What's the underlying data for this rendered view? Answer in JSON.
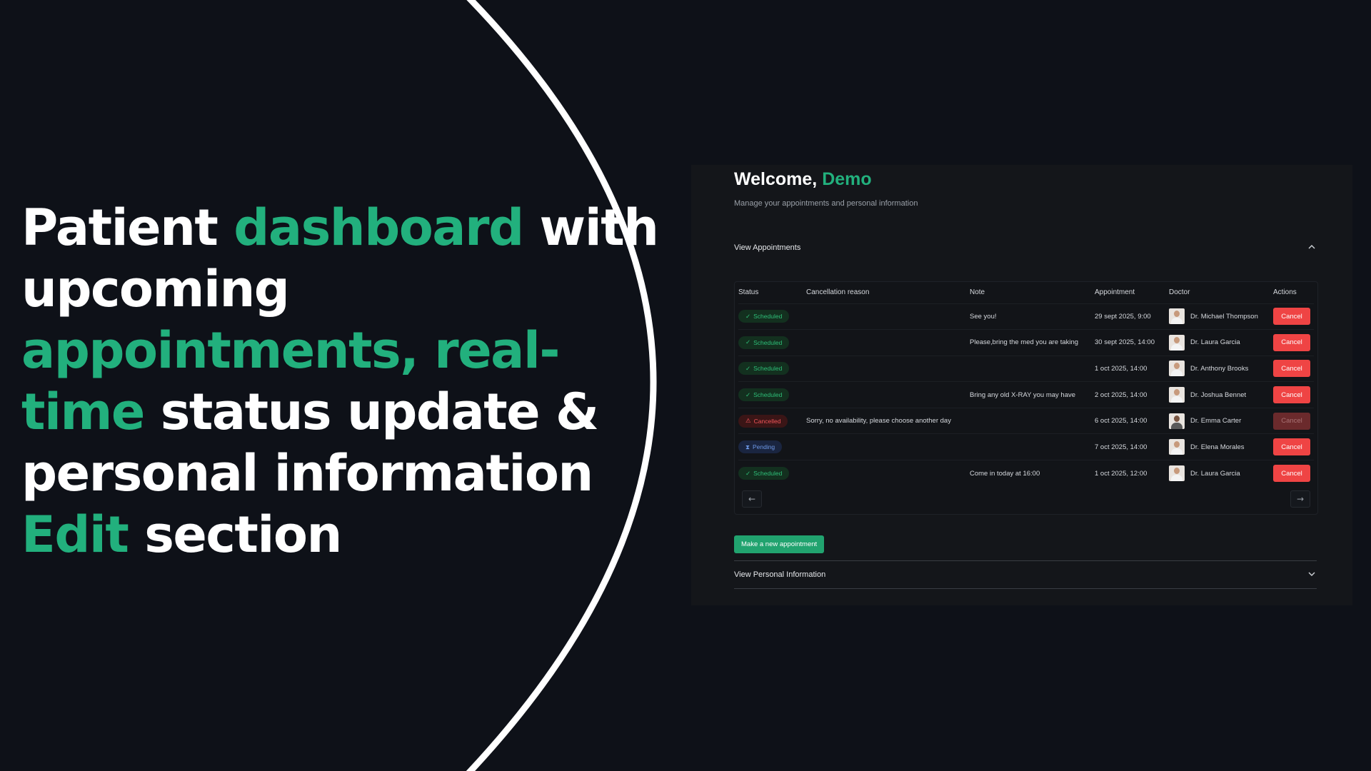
{
  "headline": {
    "segments": [
      {
        "text": "Patient ",
        "accent": false
      },
      {
        "text": "dashboard",
        "accent": true
      },
      {
        "text": " with upcoming ",
        "accent": false
      },
      {
        "text": "appointments, real-time",
        "accent": true
      },
      {
        "text": " status update & personal information ",
        "accent": false
      },
      {
        "text": "Edit",
        "accent": true
      },
      {
        "text": " section",
        "accent": false
      }
    ]
  },
  "colors": {
    "accent": "#22b07d",
    "background": "#0e1118",
    "panel": "#14161a",
    "danger": "#ef4444"
  },
  "dashboard": {
    "welcome_prefix": "Welcome, ",
    "user_name": "Demo",
    "subtitle": "Manage your appointments and personal information",
    "appointments_section": {
      "label": "View Appointments",
      "expanded": true,
      "chevron_icon": "chevron-up-icon"
    },
    "table": {
      "columns": [
        "Status",
        "Cancellation reason",
        "Note",
        "Appointment",
        "Doctor",
        "Actions"
      ],
      "rows": [
        {
          "status": "Scheduled",
          "status_type": "scheduled",
          "status_icon": "check-icon",
          "reason": "",
          "note": "See you!",
          "appointment": "29 sept 2025, 9:00",
          "doctor": "Dr. Michael Thompson",
          "action": "Cancel",
          "action_disabled": false
        },
        {
          "status": "Scheduled",
          "status_type": "scheduled",
          "status_icon": "check-icon",
          "reason": "",
          "note": "Please,bring the med you are taking",
          "appointment": "30 sept 2025, 14:00",
          "doctor": "Dr. Laura Garcia",
          "action": "Cancel",
          "action_disabled": false
        },
        {
          "status": "Scheduled",
          "status_type": "scheduled",
          "status_icon": "check-icon",
          "reason": "",
          "note": "",
          "appointment": "1 oct 2025, 14:00",
          "doctor": "Dr. Anthony Brooks",
          "action": "Cancel",
          "action_disabled": false
        },
        {
          "status": "Scheduled",
          "status_type": "scheduled",
          "status_icon": "check-icon",
          "reason": "",
          "note": "Bring any old X-RAY you may have",
          "appointment": "2 oct 2025, 14:00",
          "doctor": "Dr. Joshua Bennet",
          "action": "Cancel",
          "action_disabled": false
        },
        {
          "status": "Cancelled",
          "status_type": "cancelled",
          "status_icon": "warning-icon",
          "reason": "Sorry, no availability, please choose another day",
          "note": "",
          "appointment": "6 oct 2025, 14:00",
          "doctor": "Dr. Emma Carter",
          "action": "Cancel",
          "action_disabled": true
        },
        {
          "status": "Pending",
          "status_type": "pending",
          "status_icon": "hourglass-icon",
          "reason": "",
          "note": "",
          "appointment": "7 oct 2025, 14:00",
          "doctor": "Dr. Elena Morales",
          "action": "Cancel",
          "action_disabled": false
        },
        {
          "status": "Scheduled",
          "status_type": "scheduled",
          "status_icon": "check-icon",
          "reason": "",
          "note": "Come in today at 16:00",
          "appointment": "1 oct 2025, 12:00",
          "doctor": "Dr. Laura Garcia",
          "action": "Cancel",
          "action_disabled": false
        }
      ]
    },
    "pagination": {
      "prev_icon": "arrow-left-icon",
      "next_icon": "arrow-right-icon"
    },
    "new_appointment_label": "Make a new appointment",
    "personal_section": {
      "label": "View Personal Information",
      "expanded": false,
      "chevron_icon": "chevron-down-icon"
    }
  }
}
